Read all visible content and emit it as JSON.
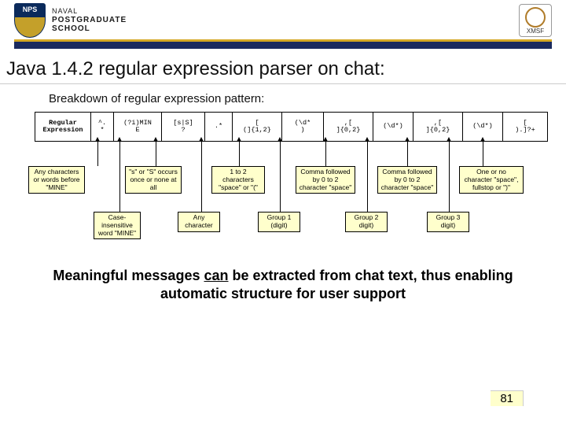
{
  "header": {
    "shield_text": "NPS",
    "org_l1": "NAVAL",
    "org_l2": "POSTGRADUATE",
    "org_l3": "SCHOOL",
    "right_logo_label": "XMSF"
  },
  "title": "Java 1.4.2 regular expression parser on chat:",
  "subtitle": "Breakdown of regular expression pattern:",
  "cells": [
    "Regular Expression",
    "^.\n*",
    "(?i)MIN\nE",
    "[s|S]\n?",
    ".*",
    "[\n(]{1,2}",
    "(\\d*\n)",
    ",[\n]{0,2}",
    "(\\d*)",
    ",[\n]{0,2}",
    "(\\d*)",
    "[\n).]?+"
  ],
  "mid_boxes": [
    "Any characters or words before \"MINE\"",
    "\"s\" or \"S\" occurs once or none at all",
    "1 to 2 characters \"space\" or \"(\"",
    "Comma followed by 0 to 2 character \"space\"",
    "Comma followed by 0 to 2 character \"space\"",
    "One or no character \"space\", fullstop or \")\""
  ],
  "low_boxes": [
    "Case-insensitive word \"MINE\"",
    "Any character",
    "Group 1 (digit)",
    "Group 2 digit)",
    "Group 3 digit)"
  ],
  "takeaway_pre": "Meaningful messages ",
  "takeaway_underline": "can",
  "takeaway_post": " be extracted from chat text, thus enabling automatic structure for user support",
  "page_number": "81"
}
